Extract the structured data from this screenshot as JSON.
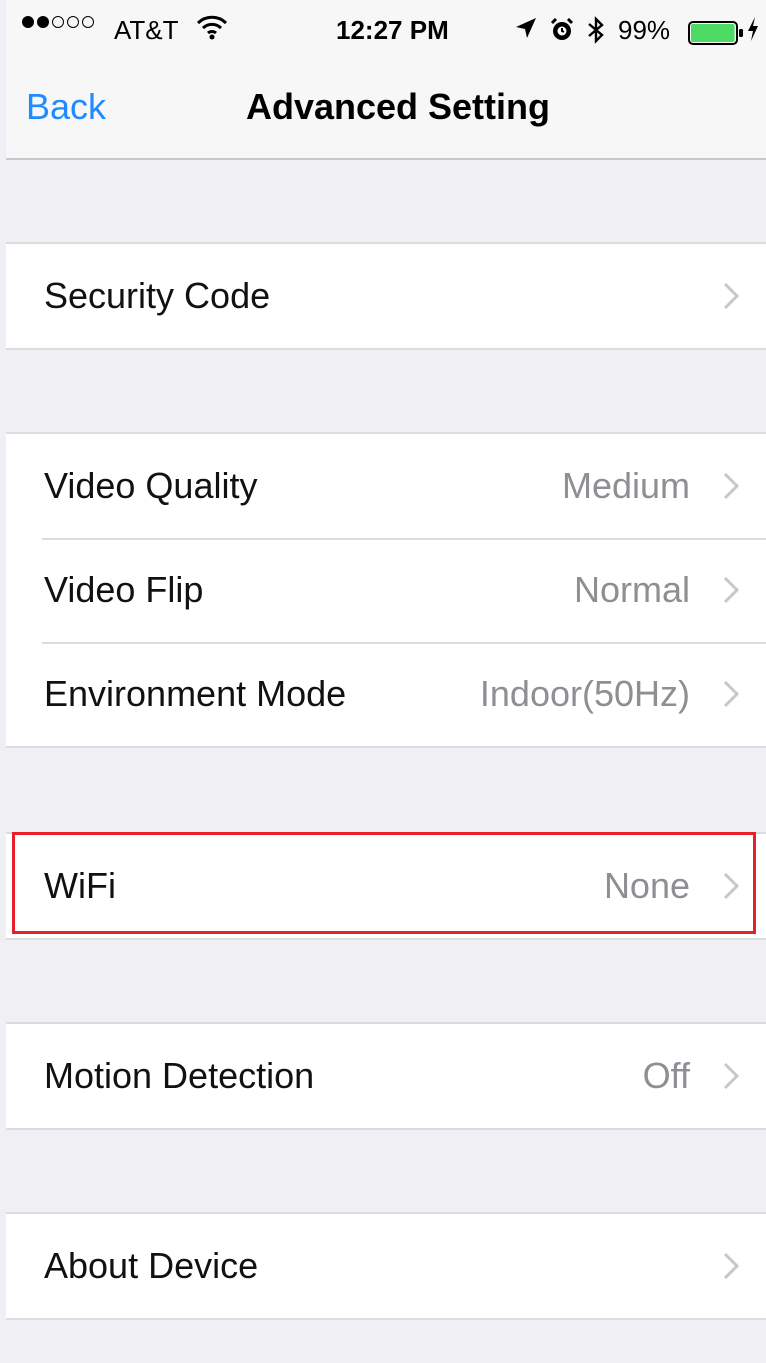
{
  "status_bar": {
    "carrier": "AT&T",
    "time": "12:27 PM",
    "battery_percent": "99%",
    "signal_bars_filled": 2,
    "signal_bars_total": 5,
    "battery_level": 0.99,
    "icons": [
      "wifi-icon",
      "location-arrow-icon",
      "alarm-clock-icon",
      "bluetooth-icon",
      "battery-icon",
      "charging-bolt-icon"
    ]
  },
  "nav": {
    "back_label": "Back",
    "title": "Advanced Setting"
  },
  "groups": [
    {
      "rows": [
        {
          "label": "Security Code",
          "value": ""
        }
      ]
    },
    {
      "rows": [
        {
          "label": "Video Quality",
          "value": "Medium"
        },
        {
          "label": "Video Flip",
          "value": "Normal"
        },
        {
          "label": "Environment Mode",
          "value": "Indoor(50Hz)"
        }
      ]
    },
    {
      "rows": [
        {
          "label": "WiFi",
          "value": "None",
          "highlighted": true
        }
      ]
    },
    {
      "rows": [
        {
          "label": "Motion Detection",
          "value": "Off"
        }
      ]
    },
    {
      "rows": [
        {
          "label": "About Device",
          "value": ""
        }
      ]
    }
  ],
  "colors": {
    "accent": "#1f8bff",
    "highlight_border": "#e8202a",
    "battery_fill": "#4cd964",
    "background": "#efeff4"
  }
}
